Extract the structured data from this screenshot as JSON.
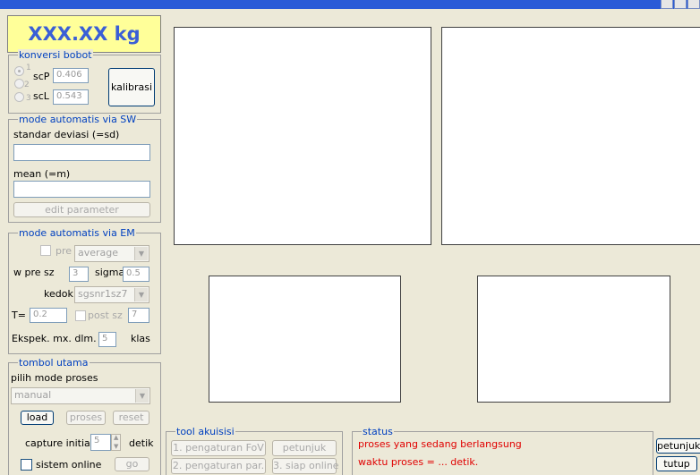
{
  "weight_display": "XXX.XX kg",
  "konversi": {
    "title": "konversi bobot",
    "radios": [
      "1",
      "2",
      "3"
    ],
    "scp_label": "scP",
    "scp_value": "0.406",
    "scl_label": "scL",
    "scl_value": "0.543",
    "kalibrasi": "kalibrasi"
  },
  "sw": {
    "title": "mode automatis via SW",
    "sd_label": "standar deviasi (=sd)",
    "mean_label": "mean (=m)",
    "edit_button": "edit parameter"
  },
  "em": {
    "title": "mode automatis via EM",
    "pre_label": "pre",
    "pre_select": "average",
    "wpre_label": "w pre sz",
    "wpre_value": "3",
    "sigma_label": "sigma",
    "sigma_value": "0.5",
    "kedok_label": "kedok",
    "kedok_select": "sgsnr1sz7",
    "t_label": "T=",
    "t_value": "0.2",
    "post_label": "post sz",
    "post_value": "7",
    "ekspek_label": "Ekspek. mx. dlm.",
    "ekspek_value": "5",
    "klas_label": "klas"
  },
  "tombol": {
    "title": "tombol utama",
    "mode_label": "pilih mode proses",
    "mode_select": "manual",
    "load": "load",
    "proses": "proses",
    "reset": "reset",
    "capture_label": "capture initial",
    "capture_value": "5",
    "detik_label": "detik",
    "sistem_label": "sistem online",
    "go": "go"
  },
  "tool": {
    "title": "tool akuisisi",
    "fov": "1. pengaturan FoV",
    "petunjuk": "petunjuk",
    "par": "2. pengaturan par.",
    "siap": "3. siap online"
  },
  "status": {
    "title": "status",
    "line1": "proses yang sedang berlangsung",
    "line2": "waktu proses = ... detik."
  },
  "right_buttons": {
    "petunjuk": "petunjuk",
    "tutup": "tutup"
  }
}
